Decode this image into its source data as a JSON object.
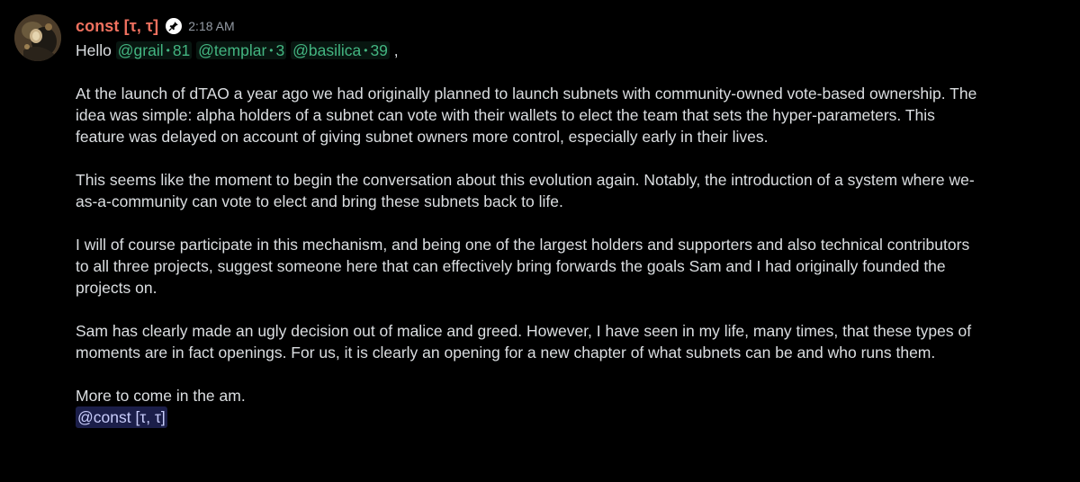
{
  "message": {
    "author": "const [τ, τ]",
    "timestamp": "2:18 AM",
    "badge_icon": "pin-badge-icon",
    "greeting_prefix": "Hello",
    "greeting_suffix": ",",
    "mentions": [
      {
        "name": "@grail",
        "count": "81"
      },
      {
        "name": "@templar",
        "count": "3"
      },
      {
        "name": "@basilica",
        "count": "39"
      }
    ],
    "paragraphs": [
      [
        "At the launch of dTAO a year ago we had originally planned to launch subnets with community-owned vote-based ownership. The",
        "idea was simple: alpha holders of a subnet can vote with their wallets to elect the team that sets the hyper-parameters. This",
        "feature was delayed on account of giving subnet owners more control, especially early in their lives."
      ],
      [
        "This seems like the moment to begin the conversation about this evolution again. Notably, the introduction of a system where we-",
        "as-a-community can vote to elect and bring these subnets back to life."
      ],
      [
        "I will of course participate in this mechanism, and being one of the largest holders and supporters and also technical contributors",
        "to all three projects, suggest someone here that can effectively bring forwards the goals Sam and I had originally founded the",
        "projects on."
      ],
      [
        "Sam has clearly made an ugly decision out of malice and greed. However, I have seen in my life, many times, that these types of",
        "moments are in fact openings. For us, it is clearly an opening for a new chapter of what subnets can be and who runs them."
      ]
    ],
    "closing": "More to come in the am.",
    "signature_mention": "@const [τ, τ]",
    "colors": {
      "background": "#000000",
      "author": "#f0715f",
      "text": "#dbdee1",
      "timestamp": "#949ba4",
      "role_mention": "#43b581",
      "user_mention_bg": "#3b3f7a",
      "user_mention_text": "#c9cdfb"
    }
  }
}
